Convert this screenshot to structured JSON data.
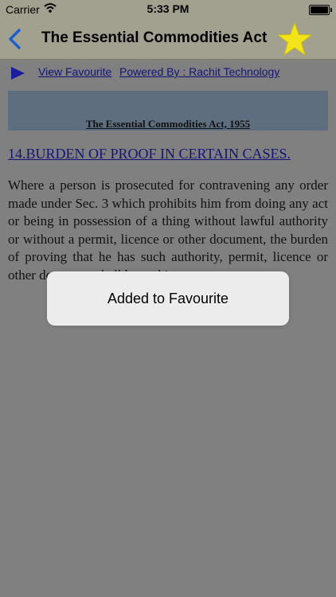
{
  "status_bar": {
    "carrier": "Carrier",
    "time": "5:33 PM"
  },
  "nav": {
    "title": "The Essential Commodities Act",
    "back_icon": "chevron-left-icon",
    "favourite_icon": "star-icon"
  },
  "links": {
    "play_icon": "play-icon",
    "view_favourite": "View Favourite",
    "powered_by": "Powered By : Rachit Technology"
  },
  "content": {
    "act_title": "The Essential Commodities Act, 1955",
    "section_heading": "14.BURDEN OF PROOF IN CERTAIN CASES.",
    "body": "Where a person is prosecuted for contravening any order made under Sec. 3 which prohibits him from doing any act or being in possession of a thing without lawful authority or without a permit, licence or other document, the burden of proving that he has such authority, permit, licence or other document shall be on him."
  },
  "toast": {
    "message": "Added to Favourite"
  },
  "colors": {
    "nav_background": "#a2a08e",
    "overlay_background": "#808080",
    "link": "#141478",
    "star": "#f2e418",
    "back_chevron": "#1a5fd0"
  }
}
